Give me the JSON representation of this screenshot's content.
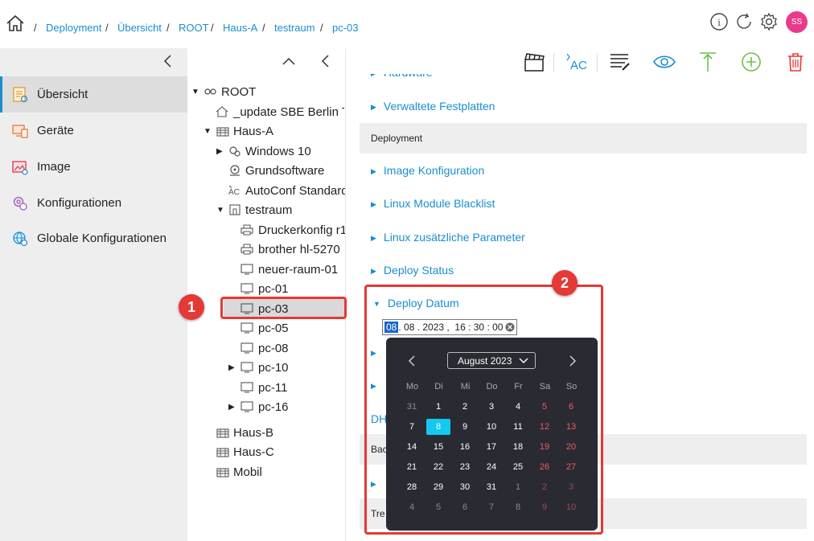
{
  "breadcrumb": {
    "sep": "/",
    "items": [
      "Deployment",
      "Übersicht",
      "ROOT",
      "Haus-A",
      "testraum",
      "pc-03"
    ]
  },
  "user": {
    "initials": "SS"
  },
  "sidebar": {
    "items": [
      {
        "label": "Übersicht",
        "icon": "overview-icon"
      },
      {
        "label": "Geräte",
        "icon": "devices-icon"
      },
      {
        "label": "Image",
        "icon": "image-icon"
      },
      {
        "label": "Konfigurationen",
        "icon": "config-icon"
      },
      {
        "label": "Globale Konfigurationen",
        "icon": "global-config-icon"
      }
    ]
  },
  "tree": {
    "root": "ROOT",
    "update": "_update SBE Berlin T",
    "haus_a": "Haus-A",
    "windows": "Windows 10",
    "grundsoftware": "Grundsoftware",
    "autoconf": "AutoConf Standard",
    "testraum": "testraum",
    "druckerkonfig": "Druckerkonfig r1",
    "brother": "brother hl-5270",
    "neuer_raum": "neuer-raum-01",
    "pc01": "pc-01",
    "pc03": "pc-03",
    "pc05": "pc-05",
    "pc08": "pc-08",
    "pc10": "pc-10",
    "pc11": "pc-11",
    "pc16": "pc-16",
    "haus_b": "Haus-B",
    "haus_c": "Haus-C",
    "mobil": "Mobil"
  },
  "main": {
    "hardware_partial": "Hardware",
    "verwaltete": "Verwaltete Festplatten",
    "deployment_group": "Deployment",
    "image_konf": "Image Konfiguration",
    "linux_blacklist": "Linux Module Blacklist",
    "linux_params": "Linux zusätzliche Parameter",
    "deploy_status": "Deploy Status",
    "deploy_datum": "Deploy Datum",
    "dh_partial": "DH",
    "bac_partial": "Bac",
    "tre_partial": "Tre"
  },
  "datefield": {
    "day": "08",
    "rest": ". 08 . 2023 ,  16 : 30 : 00"
  },
  "calendar": {
    "month_label": "August 2023",
    "weekdays": [
      "Mo",
      "Di",
      "Mi",
      "Do",
      "Fr",
      "Sa",
      "So"
    ],
    "weeks": [
      [
        "31",
        "1",
        "2",
        "3",
        "4",
        "5",
        "6"
      ],
      [
        "7",
        "8",
        "9",
        "10",
        "11",
        "12",
        "13"
      ],
      [
        "14",
        "15",
        "16",
        "17",
        "18",
        "19",
        "20"
      ],
      [
        "21",
        "22",
        "23",
        "24",
        "25",
        "26",
        "27"
      ],
      [
        "28",
        "29",
        "30",
        "31",
        "1",
        "2",
        "3"
      ],
      [
        "4",
        "5",
        "6",
        "7",
        "8",
        "9",
        "10"
      ]
    ],
    "selected": "8",
    "colors": {
      "weekend": "#f05a5a",
      "selected_bg": "#14c8f0",
      "muted": "#8a8a92"
    }
  },
  "callouts": {
    "one": "1",
    "two": "2"
  },
  "colors": {
    "accent": "#1a8dd0",
    "callout": "#e53935",
    "avatar": "#e93b8b"
  }
}
